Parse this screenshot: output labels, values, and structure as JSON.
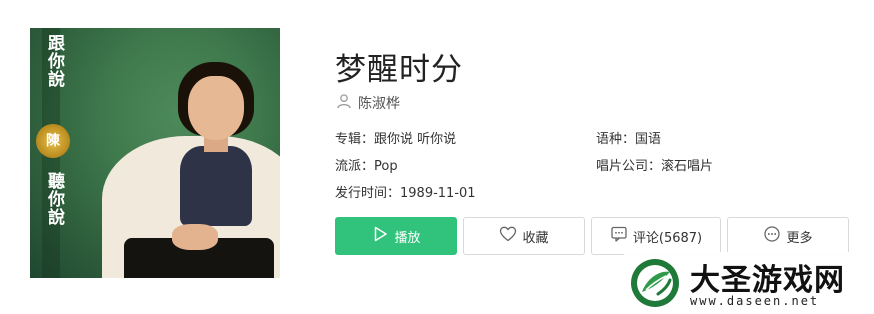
{
  "album_cover": {
    "cover_text_top": "跟你說",
    "cover_text_bottom": "聽你說",
    "badge_text": "陳"
  },
  "song": {
    "title": "梦醒时分",
    "artist": "陈淑桦"
  },
  "meta": {
    "album_label": "专辑：",
    "album_value": "跟你说 听你说",
    "language_label": "语种：",
    "language_value": "国语",
    "genre_label": "流派：",
    "genre_value": "Pop",
    "label_label": "唱片公司：",
    "label_value": "滚石唱片",
    "release_label": "发行时间：",
    "release_value": "1989-11-01"
  },
  "actions": {
    "play_label": "播放",
    "favorite_label": "收藏",
    "comment_label": "评论(5687)",
    "more_label": "更多"
  },
  "watermark": {
    "brand": "大圣游戏网",
    "url": "www.daseen.net"
  },
  "colors": {
    "accent_green": "#31c27c",
    "button_border": "#d9d9d9",
    "text": "#333333"
  },
  "icons": {
    "artist": "user-icon",
    "play": "play-icon",
    "favorite": "heart-icon",
    "comment": "comment-icon",
    "more": "more-icon"
  }
}
